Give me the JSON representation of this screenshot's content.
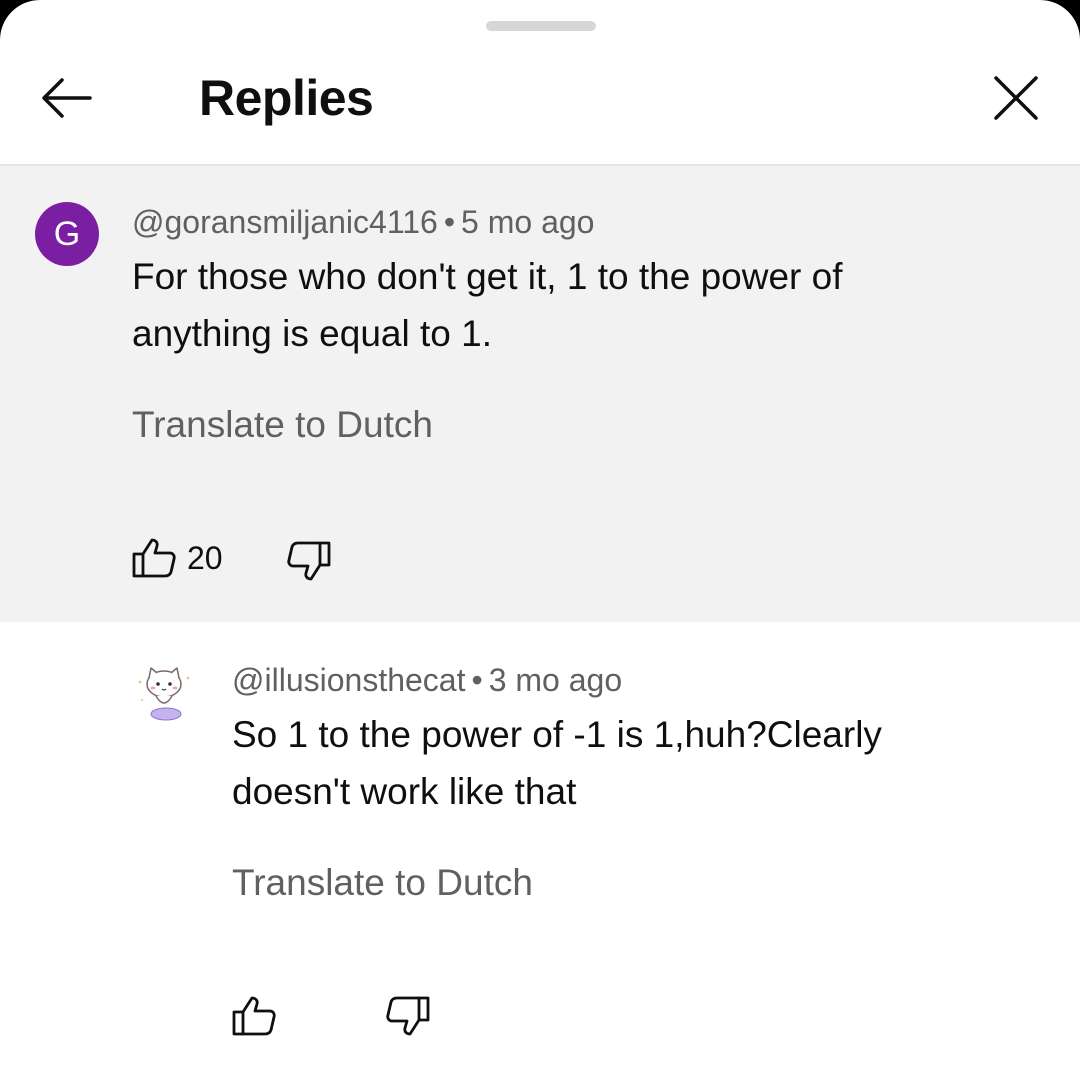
{
  "header": {
    "title": "Replies",
    "back_icon": "arrow-left-icon",
    "close_icon": "close-icon"
  },
  "comment": {
    "avatar_letter": "G",
    "avatar_color": "#7b1fa2",
    "author": "@goransmiljanic4116",
    "separator": "•",
    "time": "5 mo ago",
    "text_line1": "For those who don't get it, 1 to the power of",
    "text_line2": "anything is equal to 1.",
    "translate": "Translate to Dutch",
    "like_count": "20"
  },
  "reply": {
    "author": "@illusionsthecat",
    "separator": "•",
    "time": "3 mo ago",
    "text_line1": "So 1 to the power of -1 is 1,huh?Clearly",
    "text_line2": "doesn't work like that",
    "translate": "Translate to Dutch"
  }
}
